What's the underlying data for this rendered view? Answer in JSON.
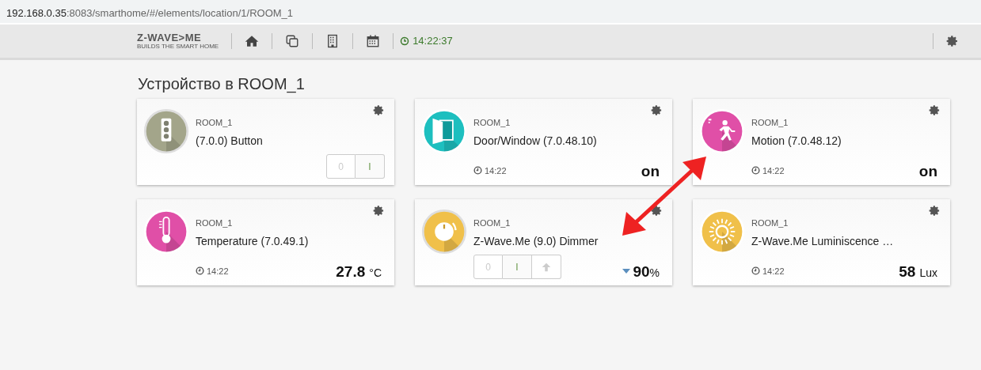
{
  "address_bar": {
    "host": "192.168.0.35",
    "rest": ":8083/smarthome/#/elements/location/1/ROOM_1"
  },
  "navbar": {
    "logo": "Z-WAVE>ME",
    "tagline": "BUILDS THE SMART HOME",
    "clock": "14:22:37"
  },
  "heading": "Устройство в ROOM_1",
  "devices": [
    {
      "kind": "button",
      "location": "ROOM_1",
      "name": "(7.0.0) Button",
      "buttons": [
        "0",
        "I"
      ]
    },
    {
      "kind": "door",
      "location": "ROOM_1",
      "name": "Door/Window (7.0.48.10)",
      "time": "14:22",
      "value": "on"
    },
    {
      "kind": "motion",
      "location": "ROOM_1",
      "name": "Motion (7.0.48.12)",
      "time": "14:22",
      "value": "on"
    },
    {
      "kind": "temperature",
      "location": "ROOM_1",
      "name": "Temperature (7.0.49.1)",
      "time": "14:22",
      "value": "27.8",
      "unit": "°C"
    },
    {
      "kind": "dimmer",
      "location": "ROOM_1",
      "name": "Z-Wave.Me (9.0) Dimmer",
      "buttons": [
        "0",
        "I"
      ],
      "value": "90",
      "unit": "%"
    },
    {
      "kind": "luminance",
      "location": "ROOM_1",
      "name": "Z-Wave.Me Luminiscence …",
      "time": "14:22",
      "value": "58",
      "unit": "Lux"
    }
  ]
}
